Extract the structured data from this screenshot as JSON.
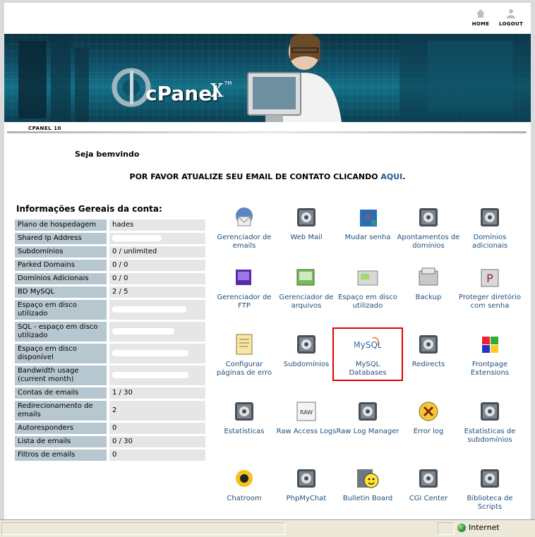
{
  "topnav": {
    "home": "HOME",
    "logout": "LOGOUT"
  },
  "banner": {
    "logo": "cPanel",
    "version": "X",
    "tm": "TM"
  },
  "theme_tag": "CPANEL 10",
  "welcome": "Seja bemvindo",
  "notice": {
    "text": "POR FAVOR ATUALIZE SEU EMAIL DE CONTATO CLICANDO ",
    "link": "AQUI",
    "suffix": "."
  },
  "info": {
    "title": "Informações Gereais da conta:",
    "rows": [
      {
        "label": "Plano de hospedagem",
        "value": "hades"
      },
      {
        "label": "Shared Ip Address",
        "value": ""
      },
      {
        "label": "Subdomínios",
        "value": "0 / unlimited"
      },
      {
        "label": "Parked Domains",
        "value": "0 / 0"
      },
      {
        "label": "Domínios Adicionais",
        "value": "0 / 0"
      },
      {
        "label": "BD MySQL",
        "value": "2 / 5"
      },
      {
        "label": "Espaço em disco utilizado",
        "value": ""
      },
      {
        "label": "SQL - espaço em disco utilizado",
        "value": ""
      },
      {
        "label": "Espaço em disco disponível",
        "value": ""
      },
      {
        "label": "Bandwidth usage (current month)",
        "value": ""
      },
      {
        "label": "Contas de emails",
        "value": "1 / 30"
      },
      {
        "label": "Redirecionamento de emails",
        "value": "2"
      },
      {
        "label": "Autoresponders",
        "value": "0"
      },
      {
        "label": "Lista de emails",
        "value": "0 / 30"
      },
      {
        "label": "Filtros de emails",
        "value": "0"
      }
    ]
  },
  "icons": [
    {
      "label": "Gerenciador de emails",
      "icon": "email-manager-icon"
    },
    {
      "label": "Web Mail",
      "icon": "webmail-icon"
    },
    {
      "label": "Mudar senha",
      "icon": "change-password-icon"
    },
    {
      "label": "Apontamentos de domínios",
      "icon": "domain-pointers-icon"
    },
    {
      "label": "Domínios adicionais",
      "icon": "addon-domains-icon"
    },
    {
      "label": "Gerenciador de FTP",
      "icon": "ftp-manager-icon"
    },
    {
      "label": "Gerenciador de arquivos",
      "icon": "file-manager-icon"
    },
    {
      "label": "Espaço em disco utilizado",
      "icon": "disk-usage-icon"
    },
    {
      "label": "Backup",
      "icon": "backup-icon"
    },
    {
      "label": "Proteger diretório com senha",
      "icon": "password-protect-icon"
    },
    {
      "label": "Configurar páginas de erro",
      "icon": "error-pages-icon"
    },
    {
      "label": "Subdomínios",
      "icon": "subdomains-icon"
    },
    {
      "label": "MySQL Databases",
      "icon": "mysql-icon",
      "logo_text": "MySQL"
    },
    {
      "label": "Redirects",
      "icon": "redirects-icon"
    },
    {
      "label": "Frontpage Extensions",
      "icon": "frontpage-icon"
    },
    {
      "label": "Estatísticas",
      "icon": "statistics-icon"
    },
    {
      "label": "Raw Access Logs",
      "icon": "raw-logs-icon",
      "badge": "RAW"
    },
    {
      "label": "Raw Log Manager",
      "icon": "raw-log-manager-icon"
    },
    {
      "label": "Error log",
      "icon": "error-log-icon"
    },
    {
      "label": "Estatísticas de subdomínios",
      "icon": "subdomain-stats-icon"
    },
    {
      "label": "Chatroom",
      "icon": "chatroom-icon"
    },
    {
      "label": "PhpMyChat",
      "icon": "phpmychat-icon"
    },
    {
      "label": "Bulletin Board",
      "icon": "bulletin-board-icon"
    },
    {
      "label": "CGI Center",
      "icon": "cgi-center-icon"
    },
    {
      "label": "Biblioteca de Scripts",
      "icon": "script-library-icon"
    }
  ],
  "statusbar": {
    "zone": "Internet"
  },
  "colors": {
    "link": "#1f4f7a",
    "label_bg": "#b7c7cf",
    "value_bg": "#e6e6e6",
    "banner": "#0f5068",
    "highlight": "#e00000"
  }
}
